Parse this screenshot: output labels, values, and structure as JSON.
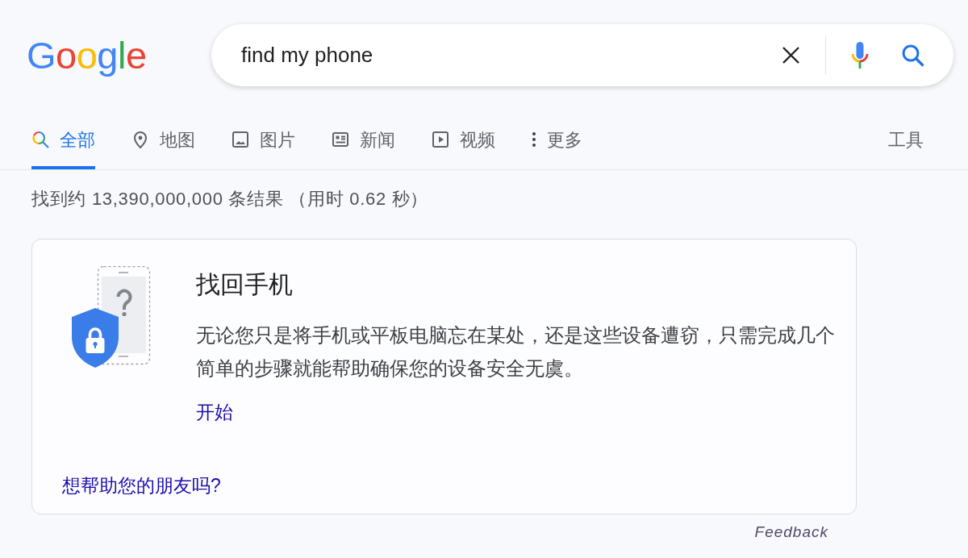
{
  "logo": "Google",
  "search": {
    "value": "find my phone"
  },
  "tabs": [
    {
      "kind": "all",
      "label": "全部",
      "selected": true
    },
    {
      "kind": "maps",
      "label": "地图",
      "selected": false
    },
    {
      "kind": "images",
      "label": "图片",
      "selected": false
    },
    {
      "kind": "news",
      "label": "新闻",
      "selected": false
    },
    {
      "kind": "videos",
      "label": "视频",
      "selected": false
    },
    {
      "kind": "more",
      "label": "更多",
      "selected": false
    }
  ],
  "tools": "工具",
  "result_stats": "找到约 13,390,000,000 条结果 （用时 0.62 秒）",
  "card": {
    "title": "找回手机",
    "description": "无论您只是将手机或平板电脑忘在某处，还是这些设备遭窃，只需完成几个简单的步骤就能帮助确保您的设备安全无虞。",
    "action": "开始",
    "help_link": "想帮助您的朋友吗?"
  },
  "feedback": "Feedback"
}
